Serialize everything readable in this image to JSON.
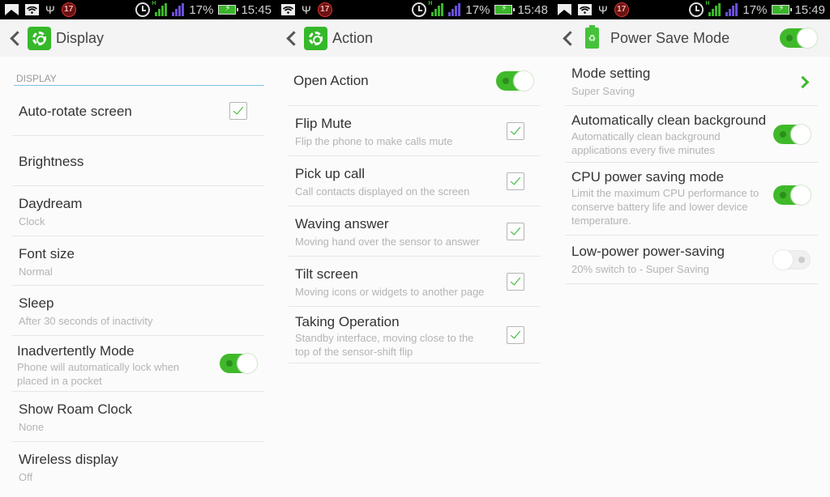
{
  "status_bar": {
    "notification_count": "17",
    "battery_percent": "17%",
    "network_type": "H",
    "times": [
      "15:45",
      "15:48",
      "15:49"
    ]
  },
  "colors": {
    "accent_green": "#3fb92a",
    "section_line": "#7ec3e8",
    "signal_secondary": "#6a4fd8"
  },
  "display": {
    "title": "Display",
    "section": "DISPLAY",
    "items": [
      {
        "title": "Auto-rotate screen",
        "subtitle": "",
        "control": "checkbox",
        "checked": true
      },
      {
        "title": "Brightness",
        "subtitle": "",
        "control": "none"
      },
      {
        "title": "Daydream",
        "subtitle": "Clock",
        "control": "none"
      },
      {
        "title": "Font size",
        "subtitle": "Normal",
        "control": "none"
      },
      {
        "title": "Sleep",
        "subtitle": "After 30 seconds of inactivity",
        "control": "none"
      },
      {
        "title": "Inadvertently Mode",
        "subtitle": "Phone will automatically lock when placed in a pocket",
        "control": "toggle",
        "on": true
      },
      {
        "title": "Show Roam Clock",
        "subtitle": "None",
        "control": "none"
      },
      {
        "title": "Wireless display",
        "subtitle": "Off",
        "control": "none"
      }
    ]
  },
  "action": {
    "title": "Action",
    "master": {
      "label": "Open Action",
      "on": true
    },
    "items": [
      {
        "title": "Flip Mute",
        "subtitle": "Flip the phone to make calls mute",
        "checked": true
      },
      {
        "title": "Pick up call",
        "subtitle": "Call contacts displayed on the screen",
        "checked": true
      },
      {
        "title": "Waving answer",
        "subtitle": "Moving hand over the sensor to answer",
        "checked": true
      },
      {
        "title": "Tilt screen",
        "subtitle": "Moving icons or widgets to another page",
        "checked": true
      },
      {
        "title": "Taking Operation",
        "subtitle": "Standby interface, moving close to the top of the sensor-shift flip",
        "checked": true
      }
    ]
  },
  "power_save": {
    "title": "Power Save Mode",
    "master_on": true,
    "items": [
      {
        "title": "Mode setting",
        "subtitle": "Super Saving",
        "control": "chevron"
      },
      {
        "title": "Automatically clean background",
        "subtitle": "Automatically clean background applications every five minutes",
        "control": "toggle",
        "on": true
      },
      {
        "title": "CPU power saving mode",
        "subtitle": "Limit the maximum CPU performance to conserve battery life and lower device temperature.",
        "control": "toggle",
        "on": true
      },
      {
        "title": "Low-power power-saving",
        "subtitle": "20% switch to - Super Saving",
        "control": "toggle",
        "on": false
      }
    ]
  }
}
